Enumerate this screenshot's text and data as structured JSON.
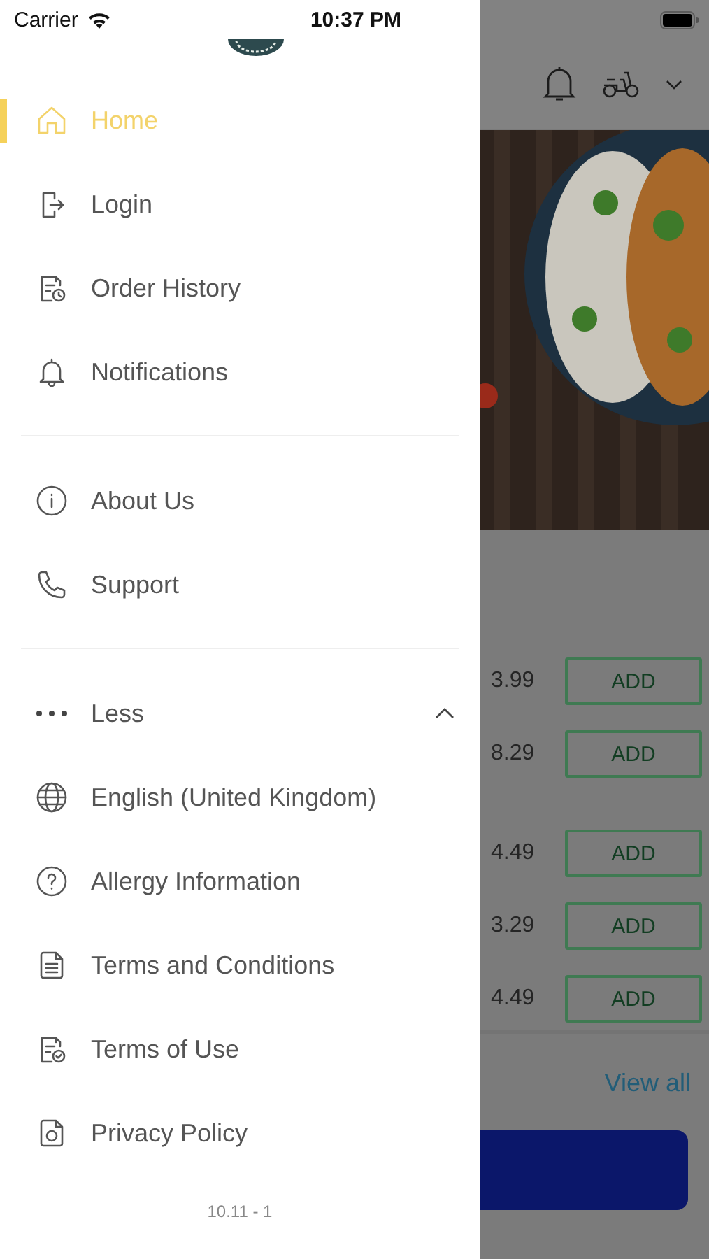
{
  "status_bar": {
    "carrier": "Carrier",
    "time": "10:37 PM"
  },
  "drawer": {
    "sections": [
      {
        "items": [
          {
            "label": "Home",
            "kind": "home",
            "selected": true
          },
          {
            "label": "Login",
            "kind": "login",
            "selected": false
          },
          {
            "label": "Order History",
            "kind": "history",
            "selected": false
          },
          {
            "label": "Notifications",
            "kind": "bell",
            "selected": false
          }
        ]
      },
      {
        "items": [
          {
            "label": "About Us",
            "kind": "info",
            "selected": false
          },
          {
            "label": "Support",
            "kind": "phone",
            "selected": false
          }
        ]
      }
    ],
    "more_toggle": {
      "label": "Less",
      "expanded": true
    },
    "more_items": [
      {
        "label": "English (United Kingdom)",
        "kind": "globe",
        "selected": false
      },
      {
        "label": "Allergy Information",
        "kind": "question",
        "selected": false
      },
      {
        "label": "Terms and Conditions",
        "kind": "document",
        "selected": false
      },
      {
        "label": "Terms of Use",
        "kind": "doc-check",
        "selected": false
      },
      {
        "label": "Privacy Policy",
        "kind": "privacy",
        "selected": false
      }
    ],
    "version": "10.11 - 1"
  },
  "background": {
    "product_groups": [
      {
        "products": [
          {
            "price": "3.99",
            "button": "ADD"
          },
          {
            "price": "8.29",
            "button": "ADD"
          }
        ]
      },
      {
        "products": [
          {
            "price": "4.49",
            "button": "ADD"
          },
          {
            "price": "3.29",
            "button": "ADD"
          },
          {
            "price": "4.49",
            "button": "ADD"
          }
        ]
      }
    ],
    "view_all": "View all"
  }
}
